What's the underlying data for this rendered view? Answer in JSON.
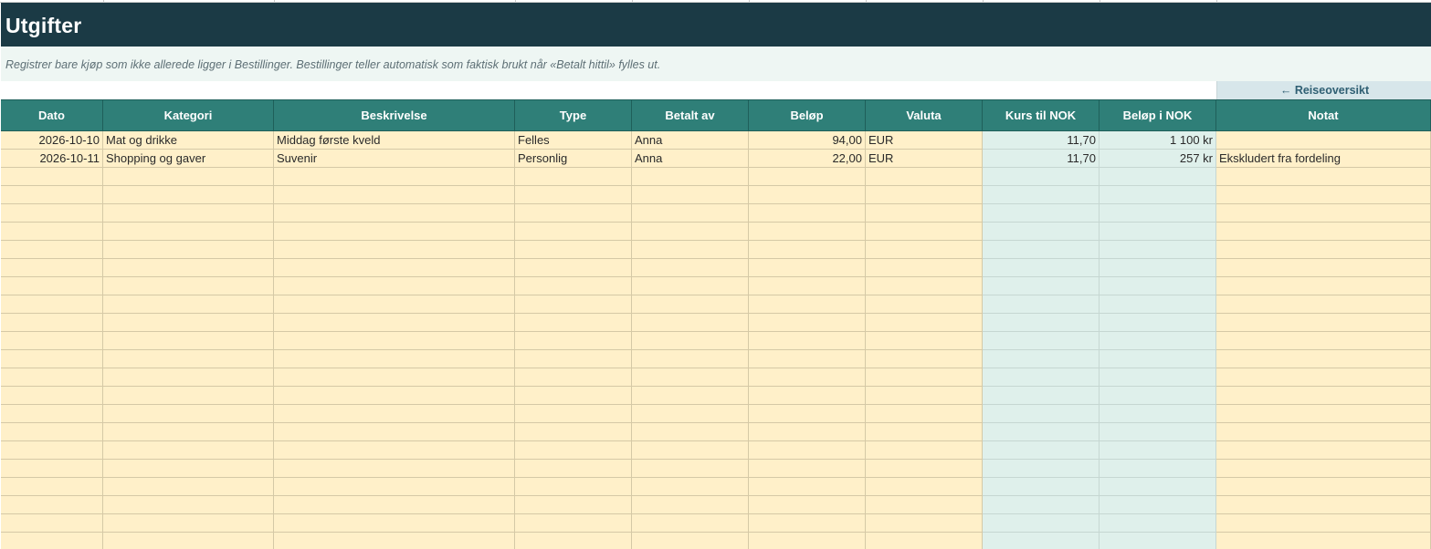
{
  "sheet": {
    "title": "Utgifter",
    "note": "Registrer bare kjøp som ikke allerede ligger i Bestillinger. Bestillinger teller automatisk som faktisk brukt når «Betalt hittil» fylles ut.",
    "back_link": "← Reiseoversikt"
  },
  "table": {
    "columns": [
      "Dato",
      "Kategori",
      "Beskrivelse",
      "Type",
      "Betalt av",
      "Beløp",
      "Valuta",
      "Kurs til NOK",
      "Beløp i NOK",
      "Notat"
    ],
    "rows": [
      [
        "2026-10-10",
        "Mat og drikke",
        "Middag første kveld",
        "Felles",
        "Anna",
        "94,00",
        "EUR",
        "11,70",
        "1 100 kr",
        ""
      ],
      [
        "2026-10-11",
        "Shopping og gaver",
        "Suvenir",
        "Personlig",
        "Anna",
        "22,00",
        "EUR",
        "11,70",
        "257 kr",
        "Ekskludert fra fordeling"
      ]
    ],
    "empty_rows": 21
  },
  "colors": {
    "title_bg": "#1b3a45",
    "header_bg": "#2f7f78",
    "input_cell": "#fff0c9",
    "calc_cell": "#dff0eb",
    "note_bg": "#eef6f3"
  }
}
